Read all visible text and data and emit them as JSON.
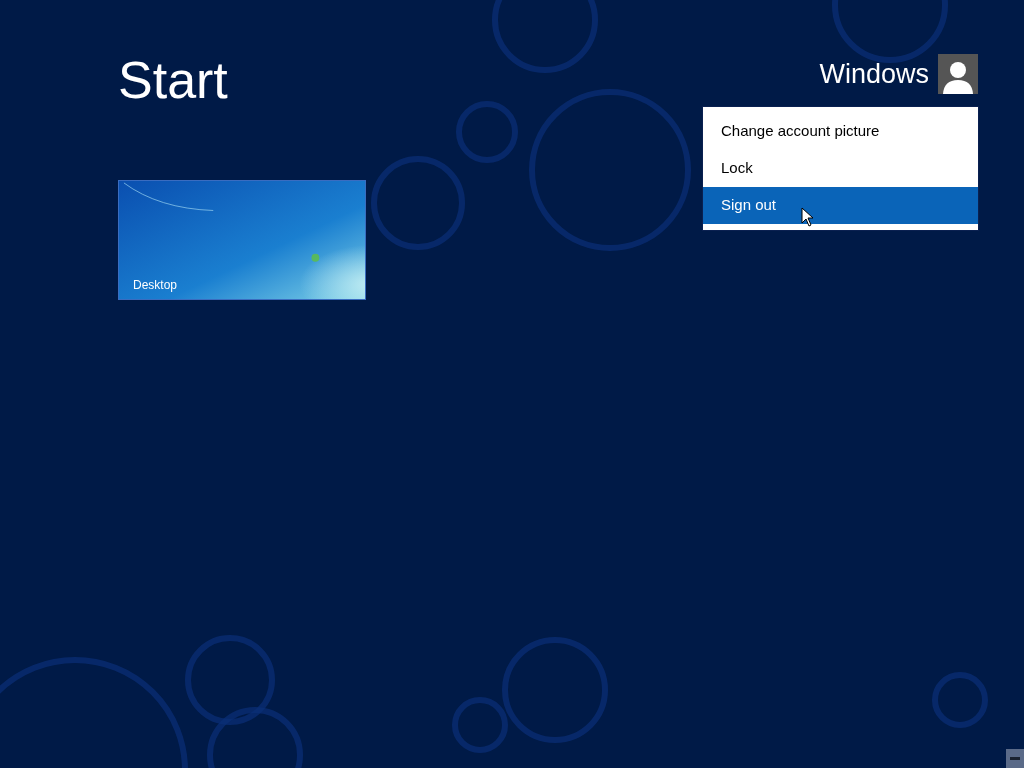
{
  "screen": {
    "title": "Start"
  },
  "user": {
    "name": "Windows"
  },
  "account_menu": {
    "items": [
      {
        "label": "Change account picture",
        "selected": false
      },
      {
        "label": "Lock",
        "selected": false
      },
      {
        "label": "Sign out",
        "selected": true
      }
    ]
  },
  "tiles": [
    {
      "label": "Desktop",
      "kind": "picture"
    }
  ]
}
